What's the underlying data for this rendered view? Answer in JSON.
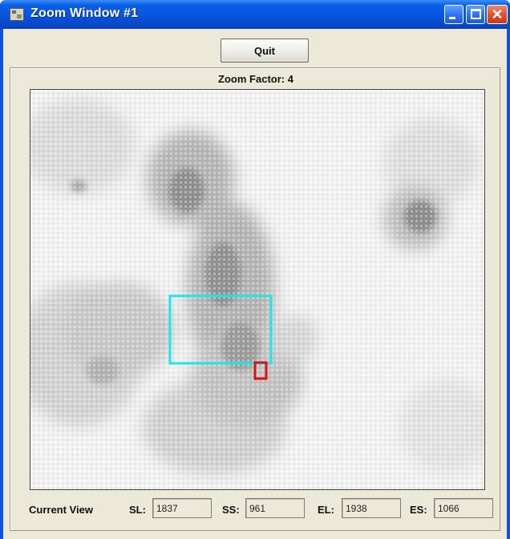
{
  "window": {
    "title": "Zoom Window #1",
    "close_glyph": "✕"
  },
  "toolbar": {
    "quit_label": "Quit"
  },
  "zoom": {
    "label": "Zoom Factor: 4",
    "current_view_label": "Current View",
    "fields": {
      "sl_label": "SL:",
      "sl_value": "1837",
      "ss_label": "SS:",
      "ss_value": "961",
      "el_label": "EL:",
      "el_value": "1938",
      "es_label": "ES:",
      "es_value": "1066"
    }
  },
  "colors": {
    "view_box": "#22e5e5",
    "cursor_box": "#dd1111",
    "title_bar": "#0754df",
    "background": "#ece9d8"
  },
  "icons": {
    "app": "image-viewer-icon",
    "minimize": "minimize-icon",
    "maximize": "maximize-icon",
    "close": "close-icon"
  }
}
